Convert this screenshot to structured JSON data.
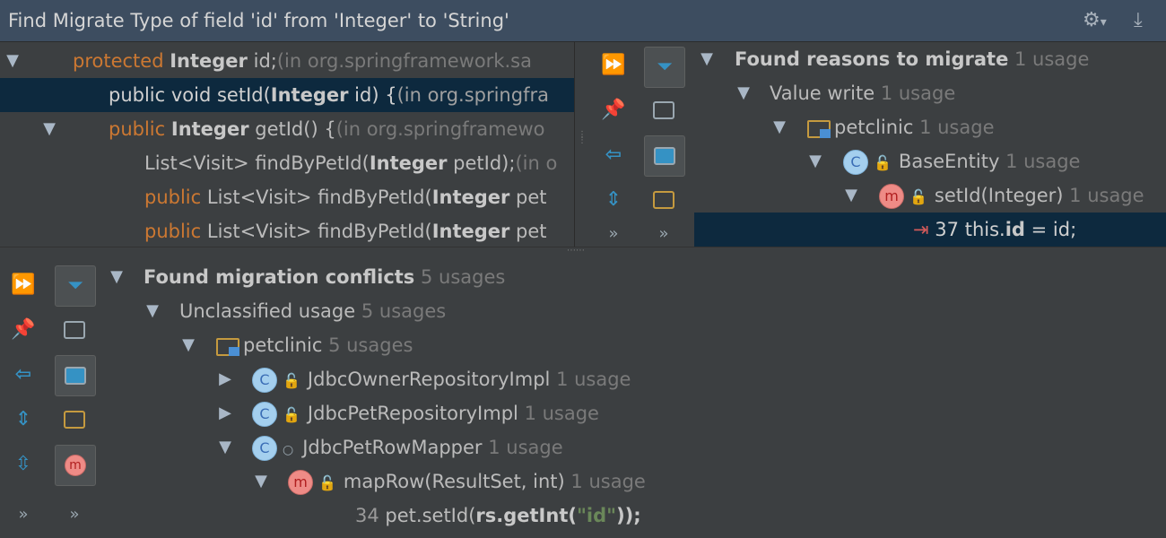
{
  "title": "Find Migrate Type of field 'id' from 'Integer' to 'String'",
  "titlebar_icons": {
    "settings": "gear-icon",
    "settings_dropdown": "▾",
    "hide": "hide-icon"
  },
  "source_tree": {
    "row1": {
      "kw": "protected",
      "type": "Integer",
      "name": "id;",
      "loc": "(in org.springframework.sa"
    },
    "row2": {
      "text1": "public void setId(",
      "type": "Integer",
      "text2": " id) {",
      "loc": "(in org.springfra"
    },
    "row3": {
      "kw": "public",
      "type": "Integer",
      "text": "getId() {",
      "loc": "(in org.springframewo"
    },
    "row4": {
      "text1": "List<Visit> findByPetId(",
      "type": "Integer",
      "text2": " petId);",
      "loc": "(in o"
    },
    "row5": {
      "kw": "public",
      "text1": "List<Visit> findByPetId(",
      "type": "Integer",
      "text2": " pet"
    },
    "row6": {
      "kw": "public",
      "text1": "List<Visit> findByPetId(",
      "type": "Integer",
      "text2": " pet"
    }
  },
  "reasons_tree": {
    "root": {
      "label": "Found reasons to migrate",
      "count": "1 usage"
    },
    "group": {
      "label": "Value write",
      "count": "1 usage"
    },
    "package": {
      "label": "petclinic",
      "count": "1 usage"
    },
    "cls": {
      "badge": "C",
      "label": "BaseEntity",
      "count": "1 usage"
    },
    "method": {
      "badge": "m",
      "label": "setId(Integer)",
      "count": "1 usage"
    },
    "line": {
      "num": "37",
      "pre": "this.",
      "bold": "id",
      "post": " = id;"
    }
  },
  "conflicts_tree": {
    "root": {
      "label": "Found migration conflicts",
      "count": "5 usages"
    },
    "group": {
      "label": "Unclassified usage",
      "count": "5 usages"
    },
    "package": {
      "label": "petclinic",
      "count": "5 usages"
    },
    "cls1": {
      "badge": "C",
      "label": "JdbcOwnerRepositoryImpl",
      "count": "1 usage"
    },
    "cls2": {
      "badge": "C",
      "label": "JdbcPetRepositoryImpl",
      "count": "1 usage"
    },
    "cls3": {
      "badge": "C",
      "label": "JdbcPetRowMapper",
      "count": "1 usage"
    },
    "method": {
      "badge": "m",
      "label": "mapRow(ResultSet, int)",
      "count": "1 usage"
    },
    "line": {
      "num": "34",
      "pre": "pet.setId(",
      "bold": "rs.getInt(",
      "str": "\"id\"",
      "post": "));"
    }
  },
  "toolbar": {
    "more": "»"
  },
  "colors": {
    "keyword": "#cc7832",
    "selection": "#0d293e",
    "titlebar": "#3d4d60",
    "string": "#6a8759"
  }
}
